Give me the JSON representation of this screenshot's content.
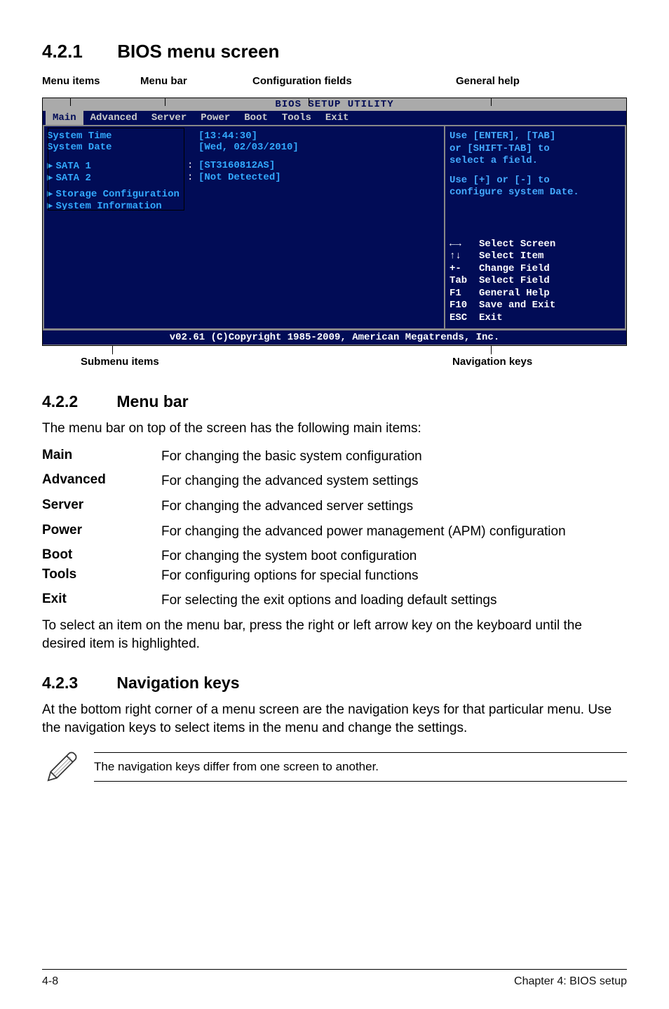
{
  "sections": {
    "s421": {
      "num": "4.2.1",
      "title": "BIOS menu screen"
    },
    "s422": {
      "num": "4.2.2",
      "title": "Menu bar"
    },
    "s423": {
      "num": "4.2.3",
      "title": "Navigation keys"
    }
  },
  "s422_intro": "The menu bar on top of the screen has the following main items:",
  "s422_outro": "To select an item on the menu bar, press the right or left arrow key on the keyboard until the desired item is highlighted.",
  "s423_body": "At the bottom right corner of a menu screen are the navigation keys for that particular menu. Use the navigation keys to select items in the menu and change the settings.",
  "note_text": "The navigation keys differ from one screen to another.",
  "callouts": {
    "menu_items": "Menu items",
    "menu_bar": "Menu bar",
    "config_fields": "Configuration fields",
    "general_help": "General help",
    "submenu_items": "Submenu items",
    "nav_keys": "Navigation keys"
  },
  "bios": {
    "title": "BIOS SETUP UTILITY",
    "menus": [
      "Main",
      "Advanced",
      "Server",
      "Power",
      "Boot",
      "Tools",
      "Exit"
    ],
    "fields": {
      "system_time": {
        "label": "System Time",
        "value": "[13:44:30]"
      },
      "system_date": {
        "label": "System Date",
        "value": "[Wed, 02/03/2010]"
      },
      "sata1": {
        "label": "SATA 1",
        "value": "[ST3160812AS]"
      },
      "sata2": {
        "label": "SATA 2",
        "value": "[Not Detected]"
      }
    },
    "subs": {
      "storage": "Storage Configuration",
      "sysinfo": "System Information"
    },
    "help1_l1": "Use [ENTER], [TAB]",
    "help1_l2": "or [SHIFT-TAB] to",
    "help1_l3": "select a field.",
    "help1_l4": "Use [+] or [-] to",
    "help1_l5": "configure system Date.",
    "nav": {
      "r1": "←→   Select Screen",
      "r2": "↑↓   Select Item",
      "r3": "+-   Change Field",
      "r4": "Tab  Select Field",
      "r5": "F1   General Help",
      "r6": "F10  Save and Exit",
      "r7": "ESC  Exit"
    },
    "footer": "v02.61 (C)Copyright 1985-2009, American Megatrends, Inc."
  },
  "desc": {
    "main": {
      "term": "Main",
      "def": "For changing the basic system configuration"
    },
    "advanced": {
      "term": "Advanced",
      "def": "For changing the advanced system settings"
    },
    "server": {
      "term": "Server",
      "def": "For changing the advanced server settings"
    },
    "power": {
      "term": "Power",
      "def": "For changing the advanced power management (APM) configuration"
    },
    "boot": {
      "term": "Boot",
      "def": "For changing the system boot configuration"
    },
    "tools": {
      "term": "Tools",
      "def": "For configuring options for special functions"
    },
    "exit": {
      "term": "Exit",
      "def": "For selecting the exit options and loading default settings"
    }
  },
  "footer": {
    "left": "4-8",
    "right": "Chapter 4: BIOS setup"
  }
}
